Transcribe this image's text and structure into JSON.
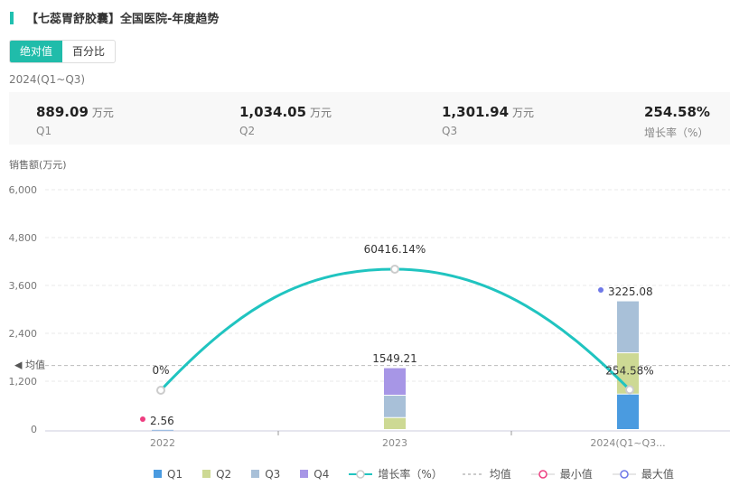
{
  "title": "【七蕊胃舒胶囊】全国医院-年度趋势",
  "toggle": {
    "absolute": "绝对值",
    "percent": "百分比"
  },
  "period": "2024(Q1~Q3)",
  "stats": [
    {
      "value": "889.09",
      "unit": "万元",
      "label": "Q1"
    },
    {
      "value": "1,034.05",
      "unit": "万元",
      "label": "Q2"
    },
    {
      "value": "1,301.94",
      "unit": "万元",
      "label": "Q3"
    },
    {
      "value": "254.58%",
      "unit": "",
      "label": "增长率（%）"
    }
  ],
  "chart_data": {
    "type": "bar",
    "ylabel": "销售额(万元)",
    "ylim": [
      0,
      6000
    ],
    "yticks": [
      "0",
      "1,200",
      "2,400",
      "3,600",
      "4,800",
      "6,000"
    ],
    "categories": [
      "2022",
      "2023",
      "2024(Q1~Q3..."
    ],
    "series": [
      {
        "name": "Q1",
        "color": "#4a9be0",
        "values": [
          2.56,
          0,
          889.09
        ]
      },
      {
        "name": "Q2",
        "color": "#cdd994",
        "values": [
          0,
          300,
          1034.05
        ]
      },
      {
        "name": "Q3",
        "color": "#a8c0d8",
        "values": [
          0,
          560,
          1301.94
        ]
      },
      {
        "name": "Q4",
        "color": "#a796e6",
        "values": [
          0,
          689.21,
          0
        ]
      }
    ],
    "totals": [
      "2.56",
      "1549.21",
      "3225.08"
    ],
    "growth": {
      "name": "增长率（%）",
      "values": [
        0,
        60416.14,
        254.58
      ],
      "labels": [
        "0%",
        "60416.14%",
        "254.58%"
      ],
      "color": "#20c4c0"
    },
    "average": {
      "label": "均值",
      "value": 1592
    },
    "min_label": "最小值",
    "max_label": "最大值"
  }
}
